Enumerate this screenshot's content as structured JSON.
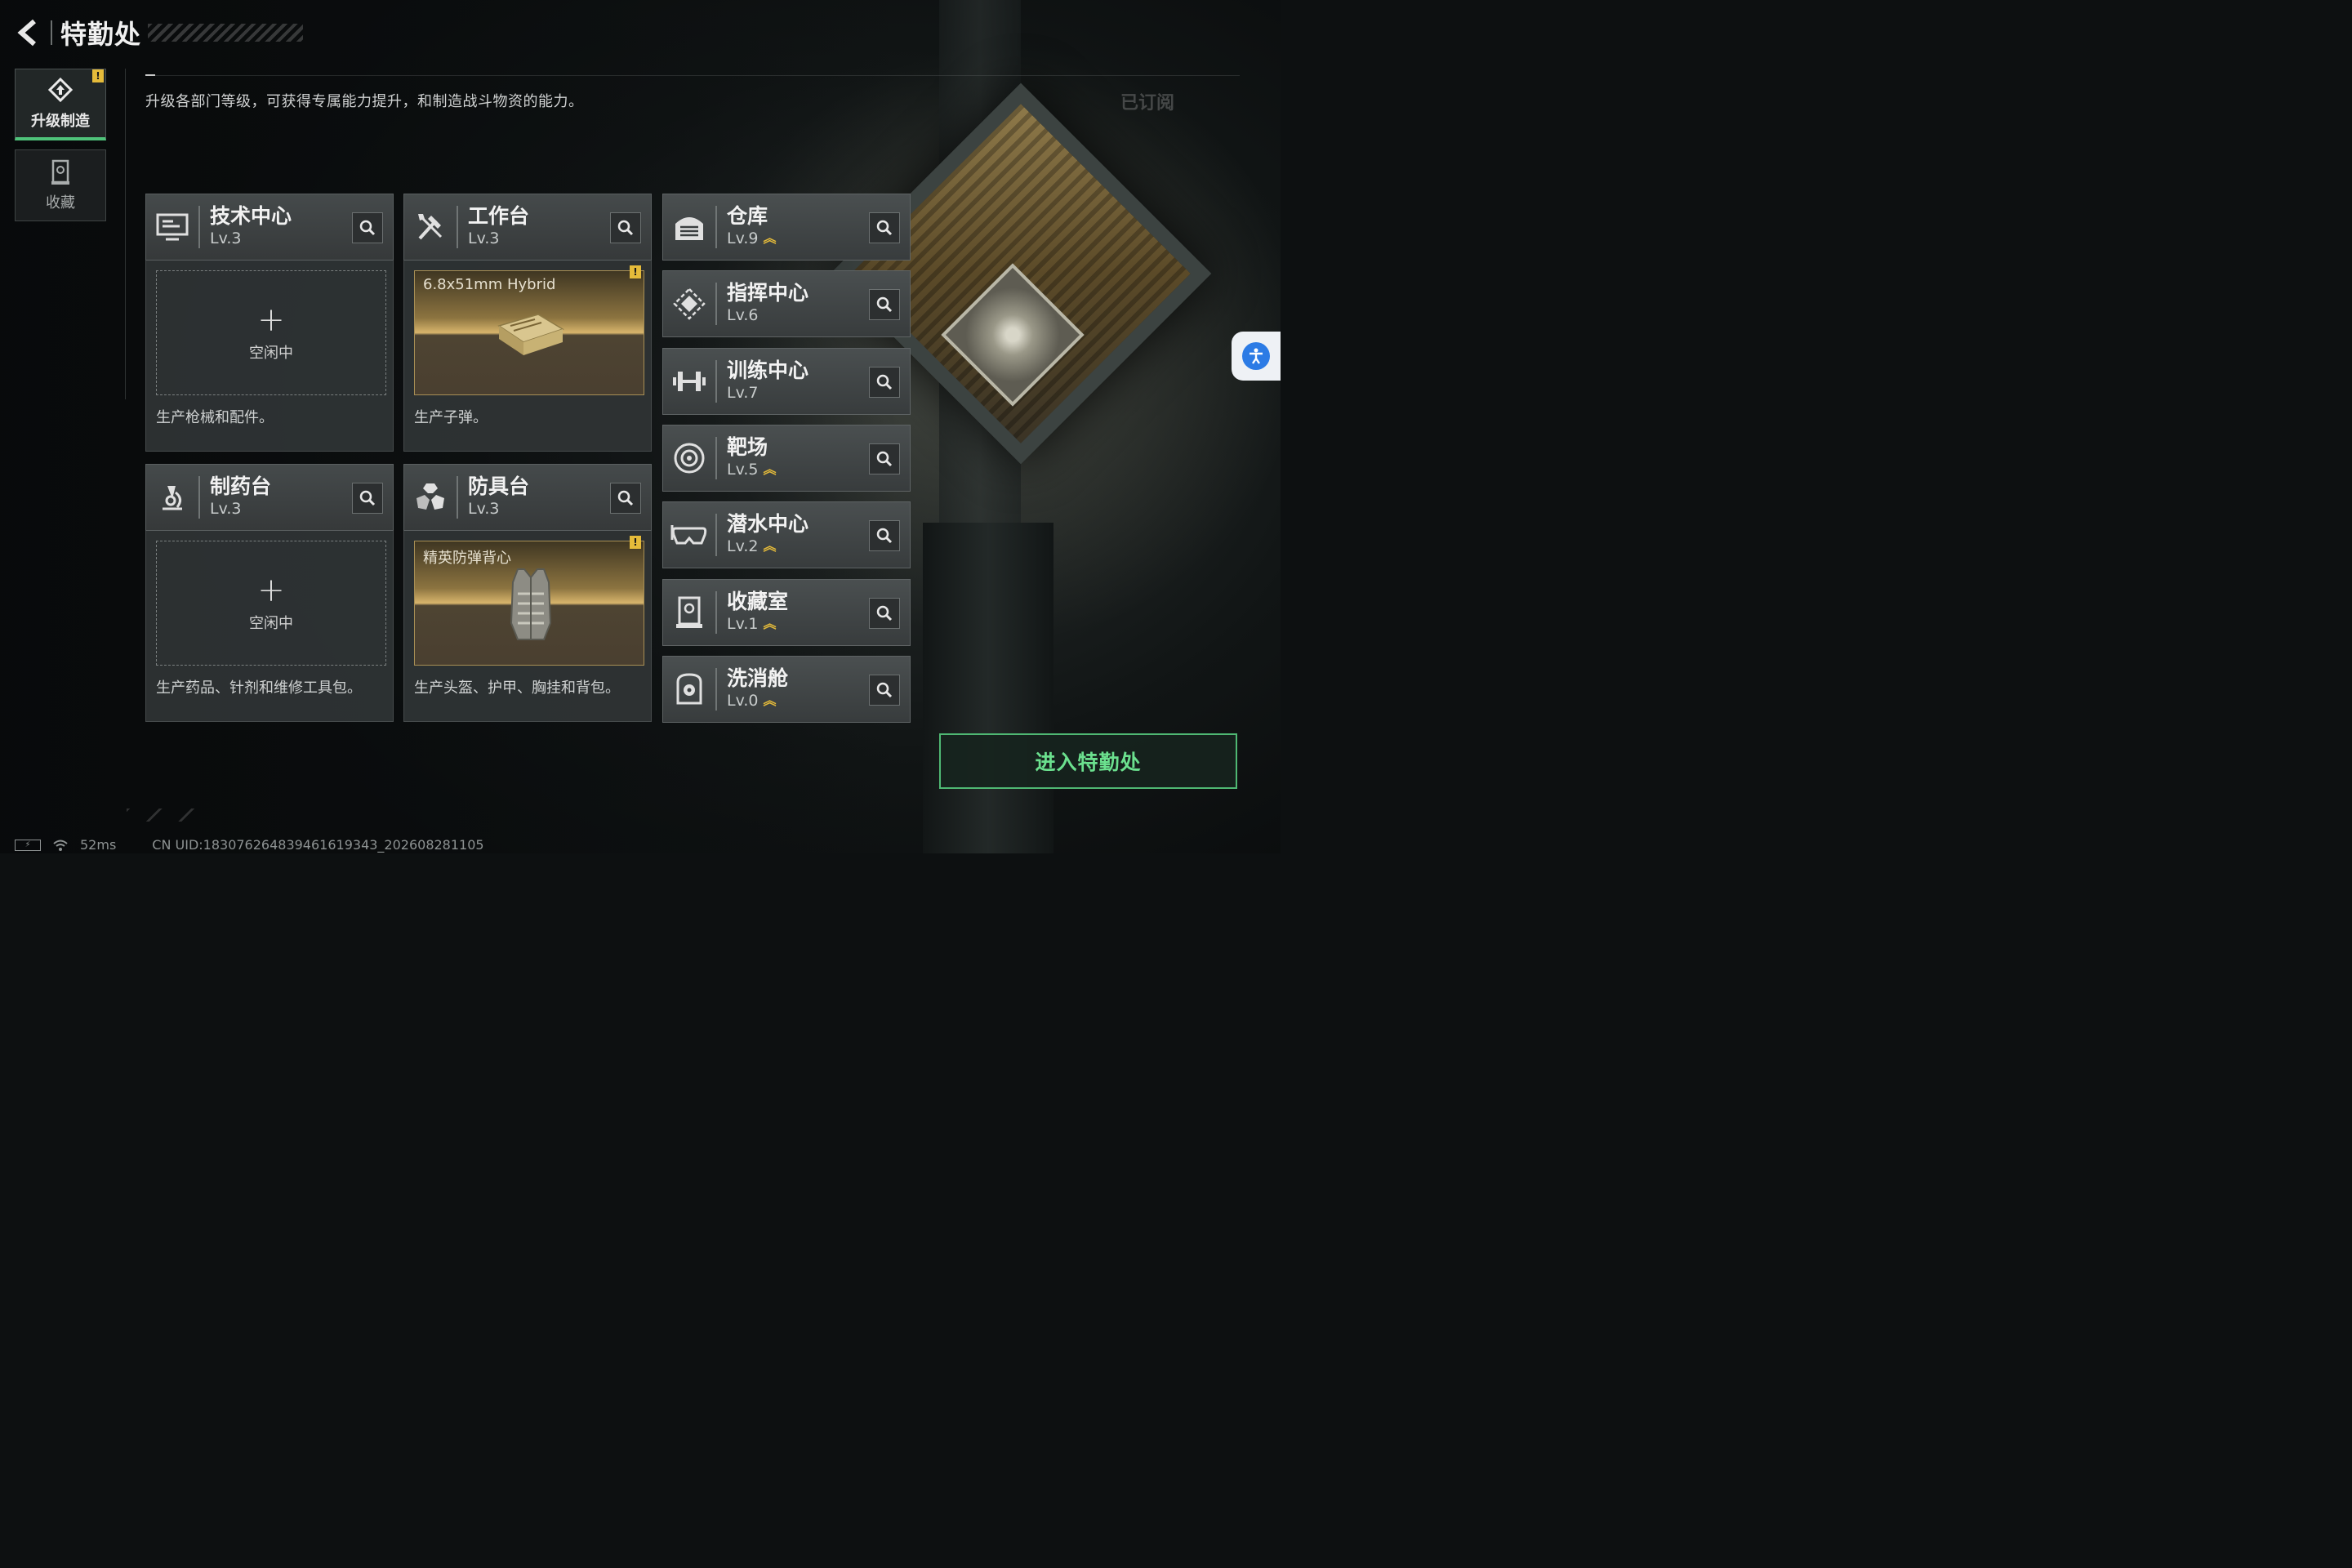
{
  "header": {
    "title": "特勤处"
  },
  "tabs": [
    {
      "label": "升级制造",
      "icon": "upgrade-icon",
      "active": true,
      "badge": "!"
    },
    {
      "label": "收藏",
      "icon": "collection-icon",
      "active": false
    }
  ],
  "description": "升级各部门等级，可获得专属能力提升，和制造战斗物资的能力。",
  "subscribed_label": "已订阅",
  "workshops": [
    {
      "name": "技术中心",
      "level": "Lv.3",
      "icon": "monitor-icon",
      "slot_state": "idle",
      "slot_label": "空闲中",
      "slot_plus": "+",
      "desc": "生产枪械和配件。"
    },
    {
      "name": "工作台",
      "level": "Lv.3",
      "icon": "tools-icon",
      "slot_state": "item",
      "slot_item": "6.8x51mm Hybrid",
      "badge": "!",
      "desc": "生产子弹。"
    },
    {
      "name": "制药台",
      "level": "Lv.3",
      "icon": "microscope-icon",
      "slot_state": "idle",
      "slot_label": "空闲中",
      "slot_plus": "+",
      "desc": "生产药品、针剂和维修工具包。"
    },
    {
      "name": "防具台",
      "level": "Lv.3",
      "icon": "armor-icon",
      "slot_state": "item",
      "slot_item": "精英防弹背心",
      "badge": "!",
      "desc": "生产头盔、护甲、胸挂和背包。"
    }
  ],
  "facilities": [
    {
      "name": "仓库",
      "level": "Lv.9",
      "icon": "warehouse-icon",
      "upgradable": true
    },
    {
      "name": "指挥中心",
      "level": "Lv.6",
      "icon": "command-icon",
      "upgradable": false
    },
    {
      "name": "训练中心",
      "level": "Lv.7",
      "icon": "dumbbell-icon",
      "upgradable": false
    },
    {
      "name": "靶场",
      "level": "Lv.5",
      "icon": "target-icon",
      "upgradable": true
    },
    {
      "name": "潜水中心",
      "level": "Lv.2",
      "icon": "diving-mask-icon",
      "upgradable": true
    },
    {
      "name": "收藏室",
      "level": "Lv.1",
      "icon": "collection-room-icon",
      "upgradable": true
    },
    {
      "name": "洗消舱",
      "level": "Lv.0",
      "icon": "decontamination-icon",
      "upgradable": true
    }
  ],
  "enter_button": "进入特勤处",
  "status_bar": {
    "ping": "52ms",
    "uid": "CN UID:18307626483946161934​3_202608281105"
  },
  "colors": {
    "accent_green": "#4fb873",
    "badge_yellow": "#e5bb3a",
    "item_gold": "#d8b56c"
  }
}
